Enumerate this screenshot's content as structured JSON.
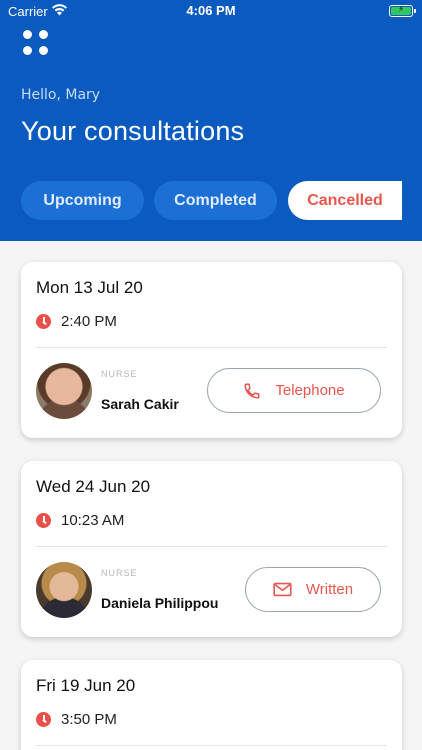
{
  "status_bar": {
    "carrier": "Carrier",
    "time": "4:06 PM"
  },
  "header": {
    "greeting": "Hello, Mary",
    "title": "Your consultations",
    "tabs": [
      {
        "label": "Upcoming"
      },
      {
        "label": "Completed"
      },
      {
        "label": "Cancelled",
        "active": true
      }
    ]
  },
  "consultations": [
    {
      "date": "Mon 13 Jul 20",
      "time": "2:40 PM",
      "role": "NURSE",
      "name": "Sarah Cakir",
      "mode": "Telephone",
      "mode_icon": "phone-icon"
    },
    {
      "date": "Wed 24 Jun 20",
      "time": "10:23 AM",
      "role": "NURSE",
      "name": "Daniela Philippou",
      "mode": "Written",
      "mode_icon": "envelope-icon"
    },
    {
      "date": "Fri 19 Jun 20",
      "time": "3:50 PM"
    }
  ],
  "colors": {
    "brand_blue": "#0a5ac0",
    "accent_red": "#e7574d",
    "clock_red": "#ea4f49"
  }
}
